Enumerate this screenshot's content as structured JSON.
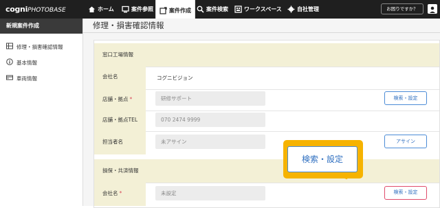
{
  "header": {
    "logo_main": "cogni",
    "logo_sub": "PHOTOBASE",
    "nav": [
      {
        "label": "ホーム",
        "icon": "home-icon"
      },
      {
        "label": "案件参照",
        "icon": "monitor-icon"
      },
      {
        "label": "案件作成",
        "icon": "create-icon",
        "active": true
      },
      {
        "label": "案件検索",
        "icon": "search-icon"
      },
      {
        "label": "ワークスペース",
        "icon": "workspace-icon"
      },
      {
        "label": "自社管理",
        "icon": "gear-icon"
      }
    ],
    "help_label": "お困りですか？"
  },
  "sidebar": {
    "heading": "新規案件作成",
    "items": [
      {
        "label": "修理・損害確認情報",
        "icon": "list-icon"
      },
      {
        "label": "基本情報",
        "icon": "info-icon"
      },
      {
        "label": "車両情報",
        "icon": "car-icon"
      }
    ]
  },
  "main": {
    "title": "修理・損害確認情報",
    "section1": {
      "heading": "窓口工場情報",
      "company_label": "会社名",
      "company_value": "コグニビジョン",
      "store_label": "店舗・拠点",
      "store_value": "研修サポート",
      "store_tel_label": "店舗・拠点TEL",
      "store_tel_value": "070 2474 9999",
      "staff_label": "担当者名",
      "staff_value": "未アサイン",
      "search_button": "検索・設定",
      "assign_button": "アサイン"
    },
    "section2": {
      "heading": "損保・共済情報",
      "company_label": "会社名",
      "company_value": "未設定",
      "search_button": "検索・設定"
    },
    "callout_label": "検索・設定"
  },
  "colors": {
    "topbar": "#1f1f1f",
    "label_bg": "#f3f0d6",
    "accent_blue": "#2f6fc0",
    "required_red": "#d94a5a",
    "highlight_pink": "#e04a6a",
    "callout_yellow": "#f6b300"
  }
}
